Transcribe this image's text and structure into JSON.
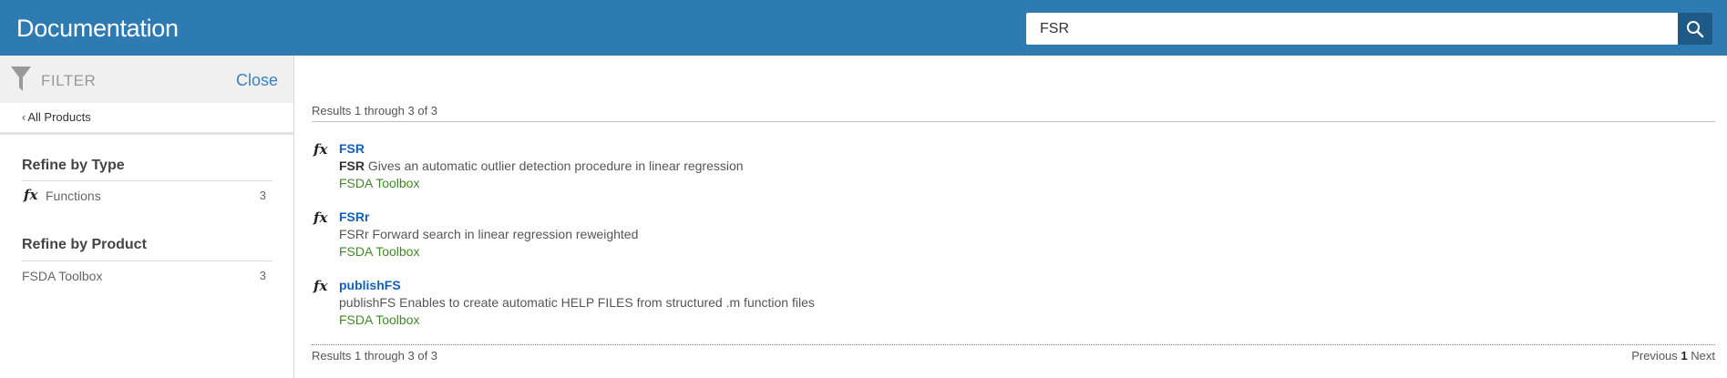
{
  "header": {
    "title": "Documentation",
    "search_value": "FSR",
    "search_icon": "search-icon"
  },
  "sidebar": {
    "filter_label": "FILTER",
    "close_label": "Close",
    "all_products_label": "All Products",
    "refine_by_type": {
      "heading": "Refine by Type",
      "items": [
        {
          "icon": "fx",
          "label": "Functions",
          "count": "3"
        }
      ]
    },
    "refine_by_product": {
      "heading": "Refine by Product",
      "items": [
        {
          "label": "FSDA Toolbox",
          "count": "3"
        }
      ]
    }
  },
  "main": {
    "summary_top": "Results 1 through 3 of 3",
    "summary_bottom": "Results 1 through 3 of 3",
    "results": [
      {
        "icon": "fx",
        "title": "FSR",
        "desc_bold": "FSR",
        "desc_rest": " Gives an automatic outlier detection procedure in linear regression",
        "product": "FSDA Toolbox"
      },
      {
        "icon": "fx",
        "title": "FSRr",
        "desc_bold": "",
        "desc_rest": "FSRr Forward search in linear regression reweighted",
        "product": "FSDA Toolbox"
      },
      {
        "icon": "fx",
        "title": "publishFS",
        "desc_bold": "",
        "desc_rest": "publishFS Enables to create automatic HELP FILES from structured .m function files",
        "product": "FSDA Toolbox"
      }
    ],
    "pager": {
      "previous": "Previous",
      "current": "1",
      "next": "Next"
    }
  },
  "colors": {
    "header_bg": "#2d7bb2",
    "search_button_bg": "#1f5a86",
    "link_blue": "#1160c0",
    "product_green": "#3d8a25"
  }
}
